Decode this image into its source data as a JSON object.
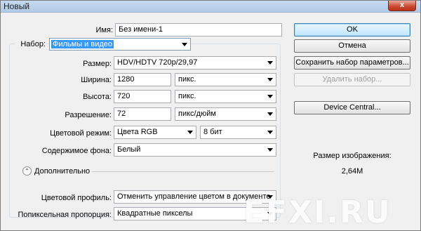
{
  "window": {
    "title": "Новый",
    "close_label": "x"
  },
  "form": {
    "name_label": "Имя:",
    "name_value": "Без имени-1",
    "preset_label": "Набор:",
    "preset_value": "Фильмы и видео",
    "size_label": "Размер:",
    "size_value": "HDV/HDTV 720p/29,97",
    "width_label": "Ширина:",
    "width_value": "1280",
    "width_unit": "пикс.",
    "height_label": "Высота:",
    "height_value": "720",
    "height_unit": "пикс.",
    "resolution_label": "Разрешение:",
    "resolution_value": "72",
    "resolution_unit": "пикс/дюйм",
    "color_mode_label": "Цветовой режим:",
    "color_mode_value": "Цвета RGB",
    "bit_depth_value": "8 бит",
    "background_label": "Содержимое фона:",
    "background_value": "Белый",
    "advanced_label": "Дополнительно",
    "color_profile_label": "Цветовой профиль:",
    "color_profile_value": "Отменить управление цветом в документе",
    "pixel_aspect_label": "Попиксельная пропорция:",
    "pixel_aspect_value": "Квадратные пикселы"
  },
  "buttons": {
    "ok": "OK",
    "cancel": "Отмена",
    "save_preset": "Сохранить набор параметров...",
    "delete_preset": "Удалить набор...",
    "device_central": "Device Central..."
  },
  "image_size": {
    "label": "Размер изображения:",
    "value": "2,64M"
  },
  "watermark": "EFXI.RU",
  "icons": {
    "expand": "chevron-up-double-icon",
    "dropdown": "triangle-down-icon",
    "close": "close-icon"
  }
}
